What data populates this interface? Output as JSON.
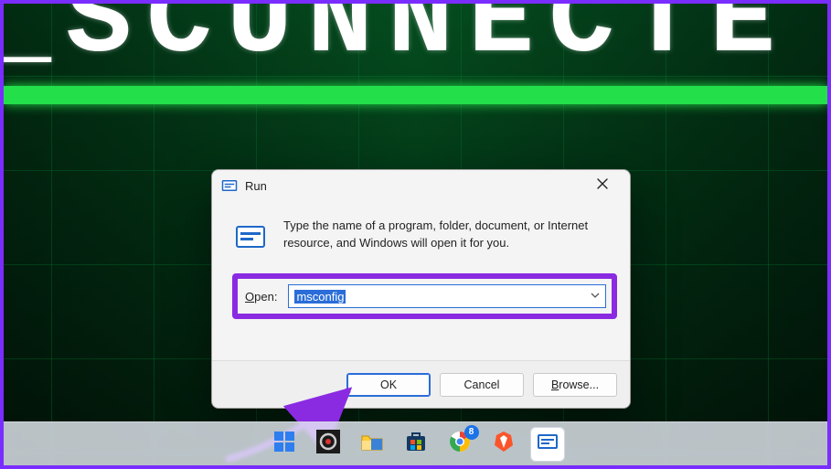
{
  "desktop": {
    "bg_text": "_SCUNNECTE"
  },
  "run_dialog": {
    "title": "Run",
    "description": "Type the name of a program, folder, document, or Internet resource, and Windows will open it for you.",
    "open_label": "Open:",
    "open_hotkey": "O",
    "input_value": "msconfig",
    "buttons": {
      "ok": "OK",
      "cancel": "Cancel",
      "browse": "Browse..."
    }
  },
  "taskbar": {
    "chrome_badge": "8"
  },
  "annotation": {
    "highlight_color": "#8a2be2"
  }
}
